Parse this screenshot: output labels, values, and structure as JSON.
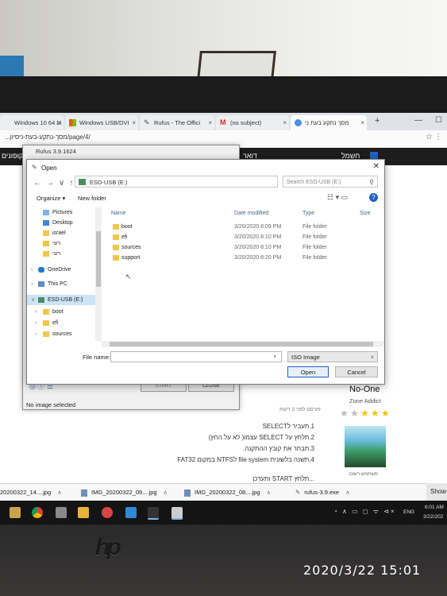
{
  "browser": {
    "tabs": [
      {
        "label": "Windows 10 64 bi",
        "icon": "page-icon"
      },
      {
        "label": "Windows USB/DVI",
        "icon": "windows-icon"
      },
      {
        "label": "Rufus - The Offici",
        "icon": "rufus-icon"
      },
      {
        "label": "(no subject)",
        "icon": "gmail-icon"
      },
      {
        "label": "מסך נתקע בעת ני",
        "icon": "chrome-icon"
      }
    ],
    "url": "...מסך-נתקע-בעת-ניסיון/page/4/",
    "site_nav": [
      "חשמל",
      "דואר",
      "קופונים"
    ]
  },
  "rufus": {
    "title": "Rufus 3.9.1624",
    "start_label": "START",
    "close_label": "CLOSE",
    "status": "No image selected"
  },
  "dialog": {
    "title": "Open",
    "address": "ESD-USB (E:)",
    "search_placeholder": "Search ESD-USB (E:)",
    "organize_label": "Organize ▾",
    "newfolder_label": "New folder",
    "nav_items": [
      "Pictures",
      "Desktop",
      "israel",
      "רוני",
      "רוני",
      "OneDrive",
      "This PC",
      "ESD-USB (E:)",
      "boot",
      "efi",
      "sources"
    ],
    "columns": {
      "name": "Name",
      "date": "Date modified",
      "type": "Type",
      "size": "Size"
    },
    "files": [
      {
        "name": "boot",
        "date": "3/20/2020 8:09 PM",
        "type": "File folder"
      },
      {
        "name": "efi",
        "date": "3/20/2020 8:10 PM",
        "type": "File folder"
      },
      {
        "name": "sources",
        "date": "3/20/2020 8:10 PM",
        "type": "File folder"
      },
      {
        "name": "support",
        "date": "3/20/2020 8:20 PM",
        "type": "File folder"
      }
    ],
    "filename_label": "File name:",
    "filetype": "ISO Image",
    "open_label": "Open",
    "cancel_label": "Cancel"
  },
  "post": {
    "posted": "פורסם לפני 3 דקות",
    "lines": [
      "1.תעביר לSELECT",
      "2.תלחץ על SELECT עצמו( לא על החץ)",
      "3.תבחר את קובץ ההתקנה.",
      "4.תשנה בלשונית file system לNTFS במקום FAT32"
    ],
    "next": "...תלחץ START ותעדכן"
  },
  "profile": {
    "name": "No-One",
    "role": "Zone Addict",
    "note": "משתמש רשום"
  },
  "show_all": "Show",
  "downloads": [
    "20200322_14....jpg",
    "IMG_20200322_09....jpg",
    "IMG_20200322_08....jpg",
    "rufus-3.9.exe"
  ],
  "taskbar": {
    "lang": "ENG",
    "time": "6:01 AM",
    "date": "3/22/202"
  },
  "photo_stamp": "2020/3/22  15:01"
}
